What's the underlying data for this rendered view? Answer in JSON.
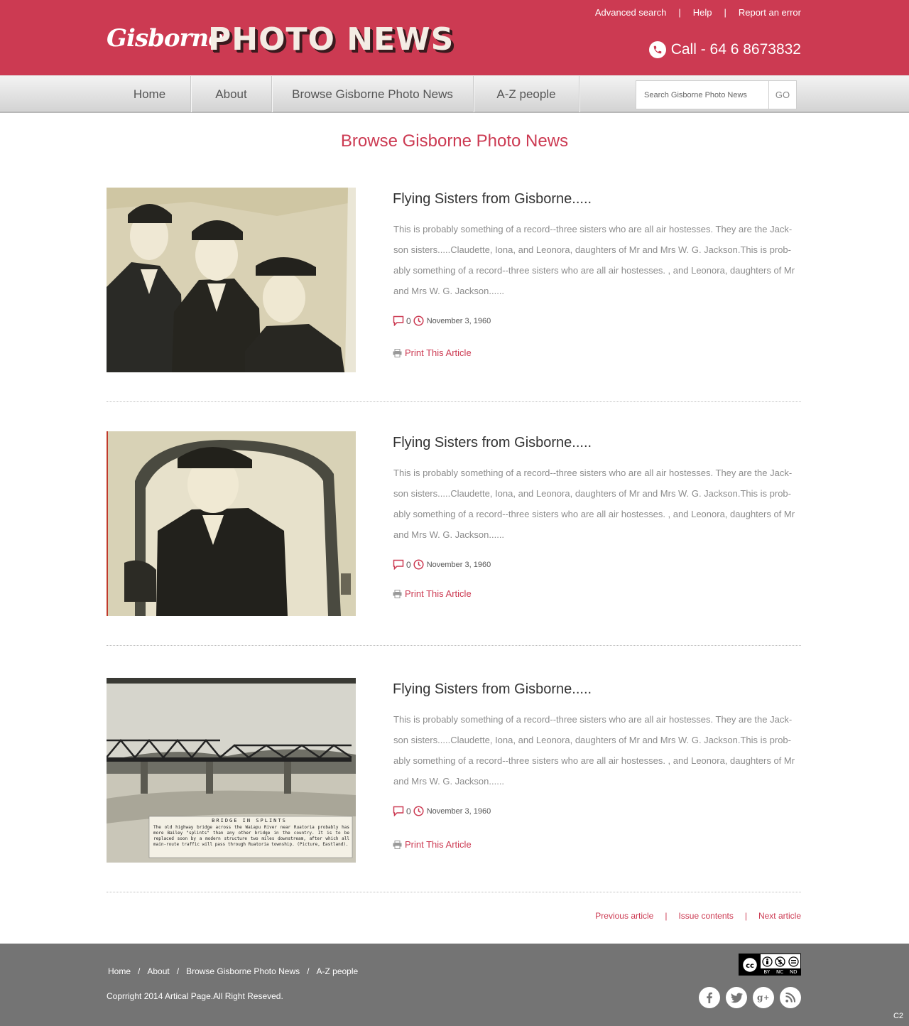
{
  "header": {
    "logo_script": "Gisborne",
    "logo_main": "PHOTO NEWS",
    "top_links": [
      "Advanced search",
      "Help",
      "Report an error"
    ],
    "top_sep": "|",
    "call": "Call - 64 6 8673832"
  },
  "nav": {
    "items": [
      "Home",
      "About",
      "Browse Gisborne Photo News",
      "A-Z people"
    ],
    "search_placeholder": "Search Gisborne Photo News",
    "search_button": "GO"
  },
  "page_title": "Browse Gisborne Photo News",
  "articles": [
    {
      "title": "Flying Sisters from Gisborne.....",
      "text": "This is probably something of a record--three sisters who are all air hostesses. They are the Jack-son sisters.....Claudette, Iona, and Leonora, daughters of Mr and Mrs W. G. Jackson.This is prob-ably something of a record--three sisters who are all air hostesses. , and Leonora, daughters of Mr and Mrs W. G. Jackson......",
      "comments": "0",
      "date": "November 3, 1960",
      "print": "Print This Article"
    },
    {
      "title": "Flying Sisters from Gisborne.....",
      "text": "This is probably something of a record--three sisters who are all air hostesses. They are the Jack-son sisters.....Claudette, Iona, and Leonora, daughters of Mr and Mrs W. G. Jackson.This is prob-ably something of a record--three sisters who are all air hostesses. , and Leonora, daughters of Mr and Mrs W. G. Jackson......",
      "comments": "0",
      "date": "November 3, 1960",
      "print": "Print This Article"
    },
    {
      "title": "Flying Sisters from Gisborne.....",
      "text": "This is probably something of a record--three sisters who are all air hostesses. They are the Jack-son sisters.....Claudette, Iona, and Leonora, daughters of Mr and Mrs W. G. Jackson.This is prob-ably something of a record--three sisters who are all air hostesses. , and Leonora, daughters of Mr and Mrs W. G. Jackson......",
      "comments": "0",
      "date": "November 3, 1960",
      "print": "Print This Article",
      "photo_caption_title": "BRIDGE IN SPLINTS",
      "photo_caption": "The old highway bridge across the Waiapu River near Ruatoria probably has more Bailey \"splints\" than any other bridge in the country. It is to be replaced soon by a modern structure two miles downstream, after which all main-route traffic will pass through Ruatoria township. (Picture, Eastland)."
    }
  ],
  "pager": {
    "previous": "Previous article",
    "contents": "Issue contents",
    "next": "Next article",
    "sep": "|"
  },
  "footer": {
    "links": [
      "Home",
      "About",
      "Browse Gisborne Photo News",
      "A-Z people"
    ],
    "sep": "/",
    "copyright": "Coprright 2014 Artical Page.All Right Reseved.",
    "cc_labels": [
      "BY",
      "NC",
      "ND"
    ],
    "social_icons": [
      "facebook-icon",
      "twitter-icon",
      "google-plus-icon",
      "rss-icon"
    ],
    "corner": "C2"
  },
  "colors": {
    "brand": "#cc3a52",
    "footer": "#747474"
  }
}
